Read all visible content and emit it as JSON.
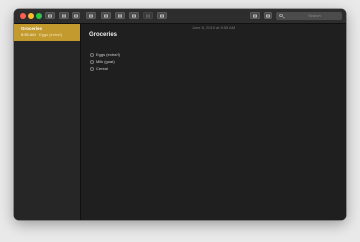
{
  "window": {
    "traffic_colors": {
      "close": "#ff5f57",
      "minimize": "#febc2e",
      "zoom": "#28c840"
    }
  },
  "toolbar": {
    "buttons": [
      {
        "icon": "sidebar-icon"
      },
      {
        "icon": "gallery-icon"
      },
      {
        "icon": "trash-icon"
      },
      {
        "icon": "compose-icon"
      },
      {
        "icon": "format-icon"
      },
      {
        "icon": "checklist-icon"
      },
      {
        "icon": "table-icon"
      },
      {
        "icon": "media-icon"
      },
      {
        "icon": "collaborate-icon"
      },
      {
        "icon": "lock-icon"
      },
      {
        "icon": "share-icon"
      }
    ],
    "search_placeholder": "Search"
  },
  "sidebar": {
    "selected_color": "#c39a2e",
    "notes": [
      {
        "title": "Groceries",
        "time": "8:55 AM",
        "preview": "Eggs (extra!)"
      }
    ]
  },
  "editor": {
    "date": "June 8, 2019 at 8:55 AM",
    "title": "Groceries",
    "checklist": [
      {
        "text": "Eggs (extra!!)",
        "checked": false
      },
      {
        "text": "Milk (goat)",
        "checked": false
      },
      {
        "text": "Cereal",
        "checked": false
      }
    ]
  }
}
